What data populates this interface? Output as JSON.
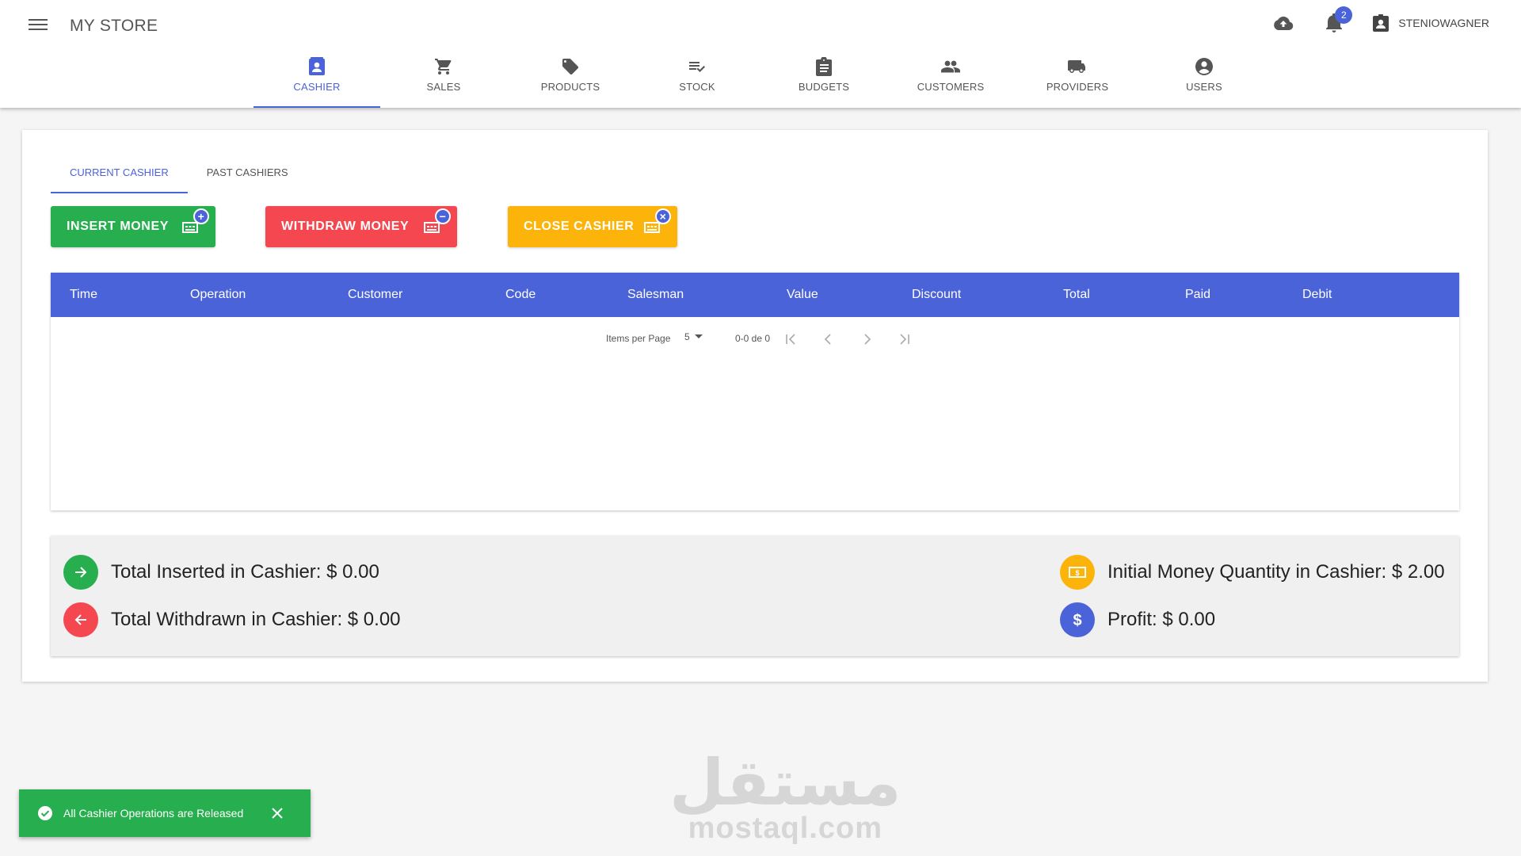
{
  "app": {
    "title": "MY STORE"
  },
  "header": {
    "notification_count": "2",
    "username": "STENIOWAGNER"
  },
  "nav_tabs": [
    {
      "label": "CASHIER",
      "icon": "cashier-icon",
      "active": true
    },
    {
      "label": "SALES",
      "icon": "cart-icon"
    },
    {
      "label": "PRODUCTS",
      "icon": "tag-icon"
    },
    {
      "label": "STOCK",
      "icon": "checklist-icon"
    },
    {
      "label": "BUDGETS",
      "icon": "clipboard-icon"
    },
    {
      "label": "CUSTOMERS",
      "icon": "people-icon"
    },
    {
      "label": "PROVIDERS",
      "icon": "truck-icon"
    },
    {
      "label": "USERS",
      "icon": "account-icon"
    }
  ],
  "sub_tabs": [
    {
      "label": "CURRENT CASHIER",
      "active": true
    },
    {
      "label": "PAST CASHIERS"
    }
  ],
  "actions": {
    "insert": "INSERT MONEY",
    "withdraw": "WITHDRAW MONEY",
    "close": "CLOSE CASHIER"
  },
  "table": {
    "columns": [
      "Time",
      "Operation",
      "Customer",
      "Code",
      "Salesman",
      "Value",
      "Discount",
      "Total",
      "Paid",
      "Debit"
    ],
    "rows": []
  },
  "pagination": {
    "items_per_page_label": "Items per Page",
    "items_per_page": "5",
    "range": "0-0 de 0"
  },
  "summary": {
    "inserted": "Total Inserted in Cashier: $ 0.00",
    "withdrawn": "Total Withdrawn in Cashier: $ 0.00",
    "initial": "Initial Money Quantity in Cashier: $ 2.00",
    "profit": "Profit: $ 0.00"
  },
  "snackbar": {
    "message": "All Cashier Operations are Released"
  },
  "watermark": {
    "arabic": "مستقل",
    "latin": "mostaql.com"
  },
  "colors": {
    "primary": "#4b63d8",
    "success": "#27ae4e",
    "danger": "#f44750",
    "warning": "#fcb40b"
  }
}
